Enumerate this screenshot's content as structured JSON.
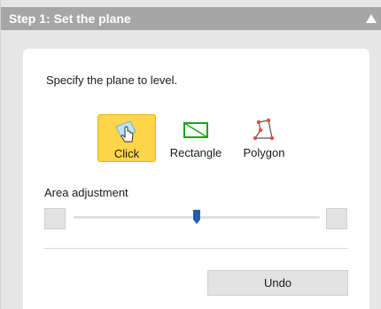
{
  "header": {
    "title": "Step 1: Set the plane",
    "collapse_icon": "triangle-up-icon"
  },
  "panel": {
    "instruction": "Specify the plane to level."
  },
  "modes": {
    "selected": "Click",
    "click": {
      "label": "Click",
      "icon": "hand-pointer-icon"
    },
    "rectangle": {
      "label": "Rectangle",
      "icon": "rectangle-icon"
    },
    "polygon": {
      "label": "Polygon",
      "icon": "polygon-icon"
    }
  },
  "area_adjustment": {
    "label": "Area adjustment",
    "value_fraction": 0.5
  },
  "undo": {
    "label": "Undo"
  },
  "colors": {
    "header_bg": "#a6a6a6",
    "selected_mode_bg": "#ffd54a",
    "slider_thumb": "#1e5fb4",
    "rectangle_icon": "#1aa31a",
    "polygon_vertex": "#e0503c"
  }
}
